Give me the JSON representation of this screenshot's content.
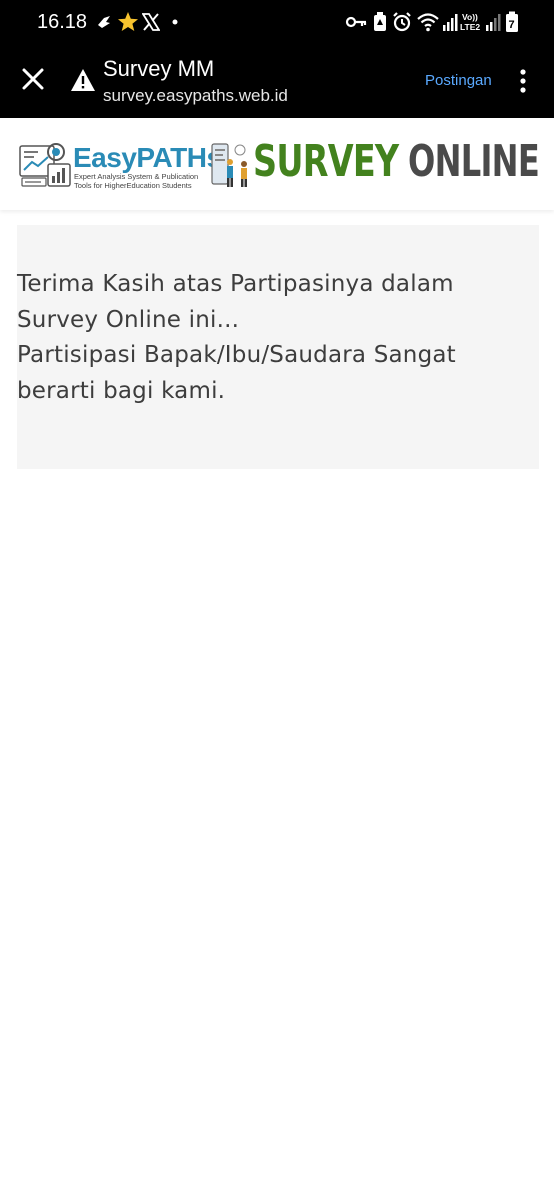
{
  "status_bar": {
    "time": "16.18",
    "notification_icons": [
      "bird-notification-icon",
      "star-icon",
      "x-logo-icon",
      "dot-icon"
    ],
    "system_icons": [
      "vpn-key-icon",
      "battery-saver-icon",
      "alarm-icon",
      "wifi-icon",
      "signal-icon",
      "volte-lte2-icon",
      "signal-icon",
      "battery-icon"
    ],
    "network_label_top": "Vo))",
    "network_label_bottom": "LTE2",
    "battery_level": "7"
  },
  "toolbar": {
    "title": "Survey MM",
    "url": "survey.easypaths.web.id",
    "action_label": "Postingan",
    "link_color": "#5aa9ff"
  },
  "header": {
    "brand": "EasyPATHs",
    "tagline_line1": "Expert Analysis System & Publication",
    "tagline_line2": "Tools for HigherEducation Students",
    "survey_word": "SURVEY",
    "online_word": "ONLINE",
    "brand_color": "#2a8bb6",
    "survey_color": "#43821e",
    "online_color": "#4a4a4a"
  },
  "message": {
    "line1": "Terima Kasih atas Partipasinya dalam Survey Online ini...",
    "line2": "Partisipasi Bapak/Ibu/Saudara Sangat berarti bagi kami."
  }
}
